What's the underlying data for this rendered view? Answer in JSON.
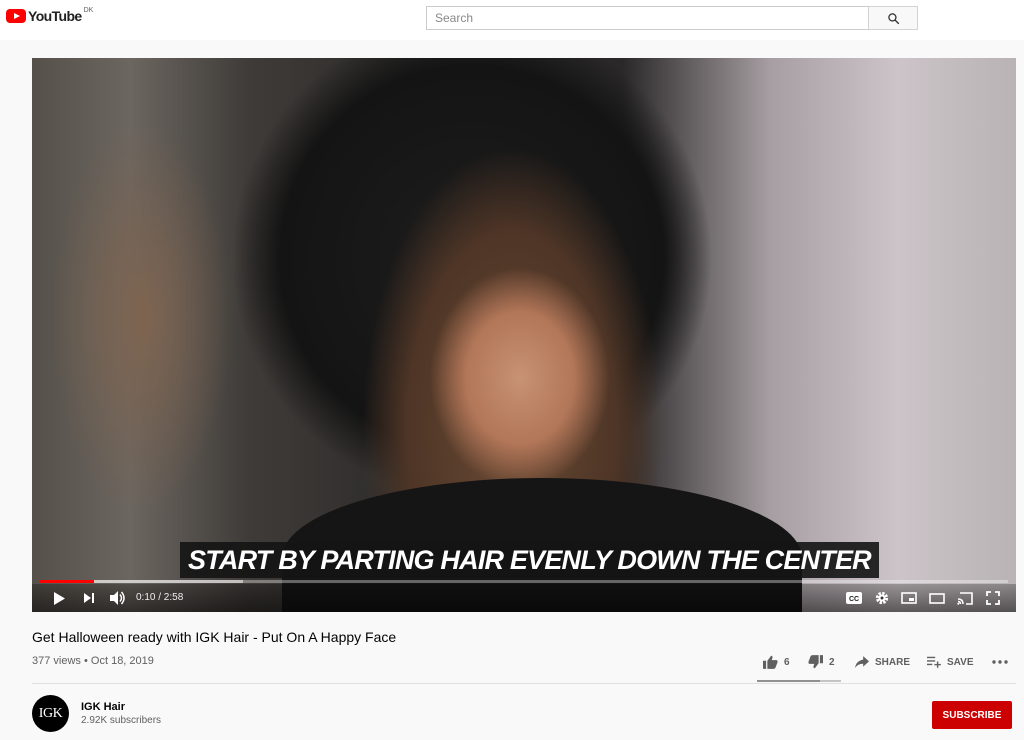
{
  "header": {
    "logo_text": "YouTube",
    "country_code": "DK",
    "search_placeholder": "Search"
  },
  "player": {
    "caption": "START BY PARTING HAIR EVENLY DOWN THE CENTER",
    "time_display": "0:10 / 2:58",
    "played_fraction": 0.056,
    "loaded_fraction": 0.21,
    "progress_color": "#ff0000"
  },
  "video": {
    "title": "Get Halloween ready with IGK Hair - Put On A Happy Face",
    "views": "377 views",
    "date": "Oct 18, 2019",
    "meta_separator": "•",
    "likes": "6",
    "dislikes": "2",
    "like_fraction": 0.75,
    "share_label": "SHARE",
    "save_label": "SAVE"
  },
  "channel": {
    "avatar_text": "IGK",
    "name": "IGK Hair",
    "subscribers": "2.92K subscribers",
    "subscribe_label": "SUBSCRIBE",
    "subscribe_color": "#cc0000"
  },
  "icons": {
    "search": "search-icon",
    "play": "play-icon",
    "next": "next-icon",
    "volume": "volume-icon",
    "cc": "cc-icon",
    "settings": "gear-icon",
    "miniplayer": "miniplayer-icon",
    "theater": "theater-icon",
    "cast": "cast-icon",
    "fullscreen": "fullscreen-icon",
    "like": "thumbs-up-icon",
    "dislike": "thumbs-down-icon",
    "share": "share-icon",
    "save": "playlist-add-icon",
    "more": "more-icon"
  }
}
